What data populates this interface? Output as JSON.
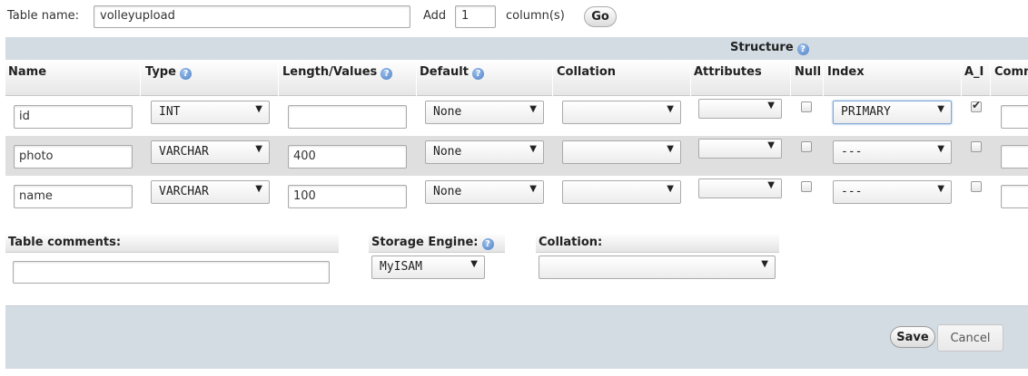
{
  "top": {
    "table_name_label": "Table name:",
    "table_name_value": "volleyupload",
    "add_label": "Add",
    "add_value": "1",
    "columns_label": "column(s)",
    "go_label": "Go"
  },
  "structure": {
    "title": "Structure",
    "help_glyph": "?",
    "columns": {
      "name": "Name",
      "type": "Type",
      "length": "Length/Values",
      "default": "Default",
      "collation": "Collation",
      "attributes": "Attributes",
      "null": "Null",
      "index": "Index",
      "ai": "A_I",
      "comments": "Comm"
    },
    "rows": [
      {
        "name": "id",
        "type": "INT",
        "length": "",
        "default": "None",
        "collation": "",
        "attributes": "",
        "null": false,
        "index": "PRIMARY",
        "ai": true
      },
      {
        "name": "photo",
        "type": "VARCHAR",
        "length": "400",
        "default": "None",
        "collation": "",
        "attributes": "",
        "null": false,
        "index": "---",
        "ai": false
      },
      {
        "name": "name",
        "type": "VARCHAR",
        "length": "100",
        "default": "None",
        "collation": "",
        "attributes": "",
        "null": false,
        "index": "---",
        "ai": false
      }
    ]
  },
  "options": {
    "table_comments_label": "Table comments:",
    "table_comments_value": "",
    "storage_engine_label": "Storage Engine:",
    "storage_engine_value": "MyISAM",
    "collation_label": "Collation:",
    "collation_value": ""
  },
  "footer": {
    "save_label": "Save",
    "cancel_label": "Cancel"
  },
  "icons": {
    "help": "help-icon",
    "dropdown": "chevron-down-icon",
    "check": "checkmark-icon"
  },
  "colors": {
    "band": "#d3dce3",
    "row_alt": "#dfdfdf",
    "help_blue": "#4d7fc3"
  }
}
